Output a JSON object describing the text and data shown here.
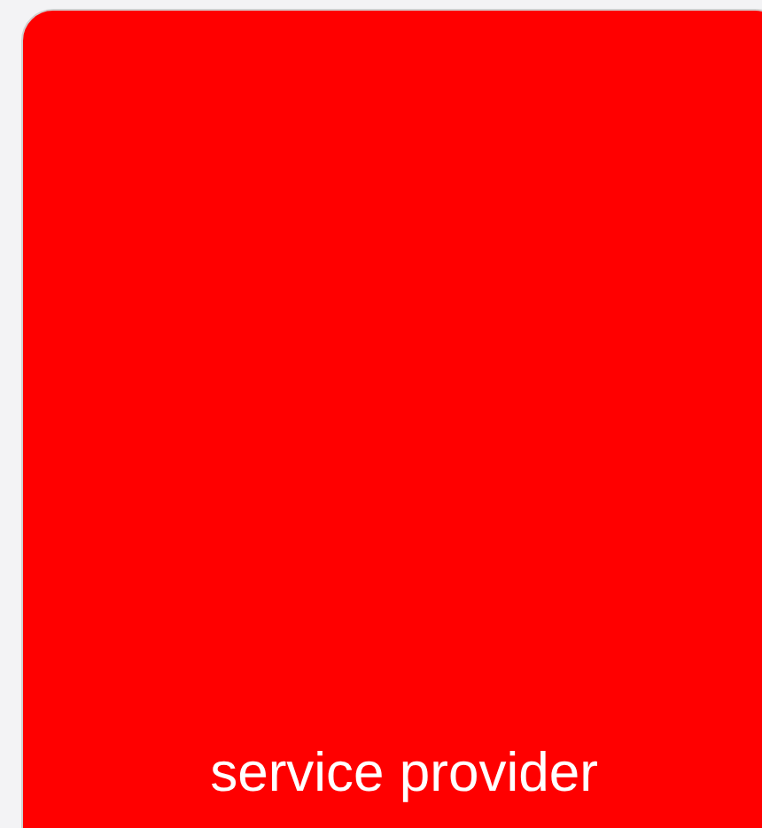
{
  "tile": {
    "label": "service provider"
  }
}
